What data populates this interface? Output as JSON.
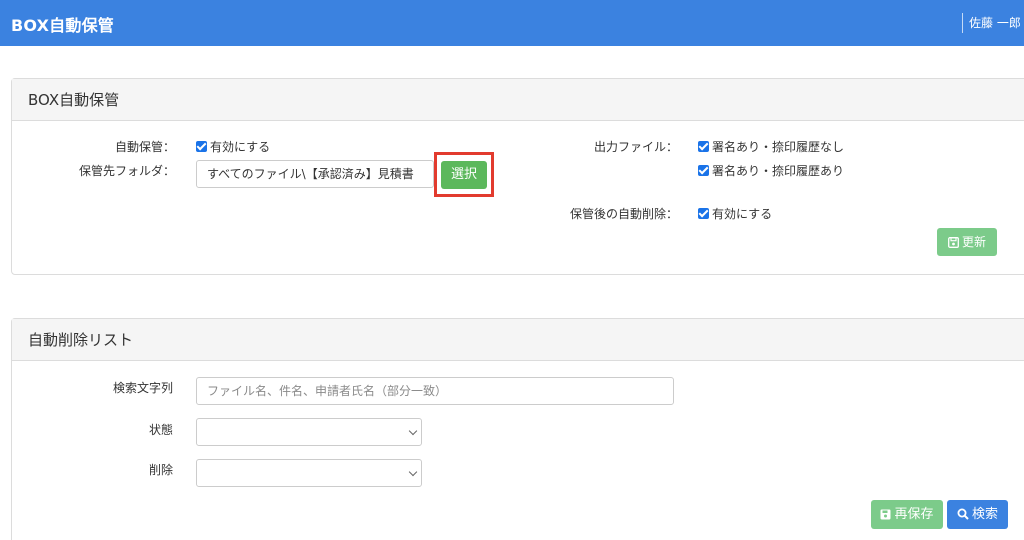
{
  "header": {
    "title": "BOX自動保管",
    "user_name": "佐藤 一郎"
  },
  "auto_storage_panel": {
    "title": "BOX自動保管",
    "auto_storage_label": "自動保管：",
    "enable_label": "有効にする",
    "folder_label": "保管先フォルダ：",
    "folder_value": "すべてのファイル\\【承認済み】見積書",
    "select_button": "選択",
    "output_file_label": "出力ファイル：",
    "output_option_1": "署名あり・捺印履歴なし",
    "output_option_2": "署名あり・捺印履歴あり",
    "auto_delete_label": "保管後の自動削除：",
    "auto_delete_enable": "有効にする",
    "update_button": "更新"
  },
  "delete_list_panel": {
    "title": "自動削除リスト",
    "search_label": "検索文字列",
    "search_placeholder": "ファイル名、件名、申請者氏名（部分一致）",
    "status_label": "状態",
    "status_value": "",
    "delete_label": "削除",
    "delete_value": "",
    "resave_button": "再保存",
    "search_button": "検索"
  },
  "colors": {
    "navbar": "#3b82e0",
    "highlight": "#e23b2e",
    "button_green": "#5cb85c",
    "button_blue": "#3b82e0"
  }
}
